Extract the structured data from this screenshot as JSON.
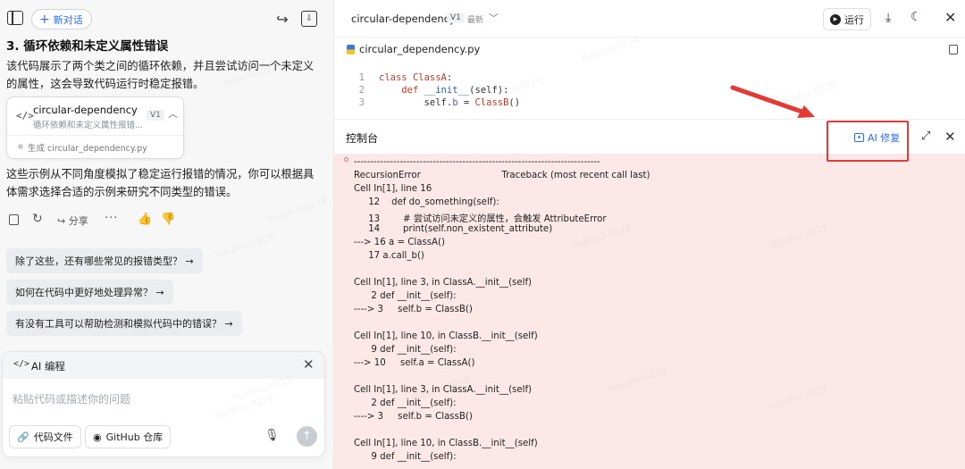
{
  "left": {
    "new_chat_label": "新对话",
    "heading": "3. 循环依赖和未定义属性错误",
    "para1": "该代码展示了两个类之间的循环依赖，并且尝试访问一个未定义的属性，这会导致代码运行时稳定报错。",
    "artifact": {
      "title": "circular-dependency",
      "subtitle": "循环依赖和未定义属性报错...",
      "version": "V1",
      "generated": "生成 circular_dependency.py"
    },
    "para2": "这些示例从不同角度模拟了稳定运行报错的情况，你可以根据具体需求选择合适的示例来研究不同类型的错误。",
    "actions": {
      "share_label": "分享"
    },
    "suggestions": [
      "除了这些，还有哪些常见的报错类型？ →",
      "如何在代码中更好地处理异常？ →",
      "有没有工具可以帮助检测和模拟代码中的错误？ →"
    ],
    "composer": {
      "title": "AI 编程",
      "placeholder": "粘贴代码或描述你的问题",
      "chip_code_files": "代码文件",
      "chip_github": "GitHub 仓库"
    }
  },
  "right": {
    "title": "circular-dependency",
    "version": "V1",
    "latest": "最新",
    "run_label": "运行",
    "file_name": "circular_dependency.py",
    "code_lines": [
      {
        "n": "1"
      },
      {
        "n": "2"
      },
      {
        "n": "3"
      }
    ],
    "console_title": "控制台",
    "ai_fix_label": "AI 修复",
    "traceback": [
      "---------------------------------------------------------------------------",
      "RecursionError                            Traceback (most recent call last)",
      "Cell In[1], line 16",
      "     12    def do_something(self):",
      "     13        # 尝试访问未定义的属性，会触发 AttributeError",
      "     14        print(self.non_existent_attribute)",
      "---> 16 a = ClassA()",
      "     17 a.call_b()",
      "",
      "Cell In[1], line 3, in ClassA.__init__(self)",
      "      2 def __init__(self):",
      "----> 3     self.b = ClassB()",
      "",
      "Cell In[1], line 10, in ClassB.__init__(self)",
      "      9 def __init__(self):",
      "---> 10     self.a = ClassA()",
      "",
      "Cell In[1], line 3, in ClassA.__init__(self)",
      "      2 def __init__(self):",
      "----> 3     self.b = ClassB()",
      "",
      "Cell In[1], line 10, in ClassB.__init__(self)",
      "      9 def __init__(self):"
    ],
    "watermark": "liujiahui.0229"
  },
  "colors": {
    "accent": "#2c6bf0",
    "error_bg": "#fde8e8",
    "highlight": "#e53935"
  }
}
